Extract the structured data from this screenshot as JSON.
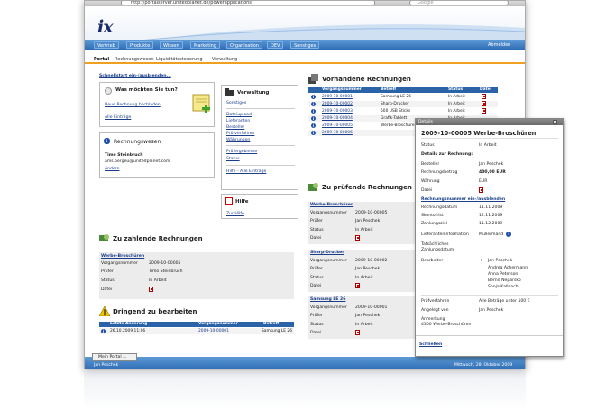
{
  "browser": {
    "url": "http://portalserver.unitedplanet.de/powerapplications/",
    "search_placeholder": "Google"
  },
  "app": {
    "logo_text": "ix"
  },
  "main_nav": [
    "Vertrieb",
    "Produkte",
    "Wissen",
    "Marketing",
    "Organisation",
    "DEV",
    "Sonstiges"
  ],
  "logout_label": "Abmelden",
  "sub_nav": [
    "Portal",
    "Rechnungswesen",
    "Liquiditätssteuerung",
    "Verwaltung"
  ],
  "quickstart_label": "Schnellstart ein-/ausblenden...",
  "wish": {
    "title": "Was möchten Sie tun?",
    "links": [
      "Neue Rechnung hochladen",
      "Alle Einträge"
    ]
  },
  "accounting_box": {
    "title": "Rechnungswesen",
    "name": "Timo Steinbruch",
    "email": "ams.bergeu@unitedplanet.com",
    "change_link": "Ändern"
  },
  "admin_box": {
    "title": "Verwaltung",
    "links": [
      "Sonstiges",
      "Dateiupload",
      "Lieferanten",
      "Besteller",
      "Prüfverfahren",
      "Währungen",
      "Prüfergebnisse",
      "Status",
      "Hilfe - Alle Einträge"
    ]
  },
  "help_box": {
    "title": "Hilfe",
    "links": [
      "Zur Hilfe"
    ]
  },
  "invoices": {
    "title": "Vorhandene Rechnungen",
    "columns": [
      "Vorgangsnummer",
      "Betreff",
      "Status",
      "Datei"
    ],
    "rows": [
      {
        "nr": "2009-10-00001",
        "subject": "Samsung LE 26",
        "status": "In Arbeit"
      },
      {
        "nr": "2009-10-00002",
        "subject": "Sharp-Drucker",
        "status": "In Arbeit"
      },
      {
        "nr": "2009-10-00003",
        "subject": "500 USB Sticks",
        "status": "In Arbeit"
      },
      {
        "nr": "2009-10-00004",
        "subject": "Grafik-Tablett",
        "status": "In Arbeit"
      },
      {
        "nr": "2009-10-00005",
        "subject": "Werbe-Broschüren",
        "status": "In Arbeit"
      },
      {
        "nr": "2009-10-00006",
        "subject": "",
        "status": ""
      }
    ]
  },
  "to_pay": {
    "title": "Zu zahlende Rechnungen",
    "item_title": "Werbe-Broschüren",
    "fields": [
      {
        "label": "Vorgangsnummer",
        "value": "2009-10-00005"
      },
      {
        "label": "Prüfer",
        "value": "Timo Steinbruch"
      },
      {
        "label": "Status",
        "value": "In Arbeit"
      },
      {
        "label": "Datei",
        "value": ""
      }
    ]
  },
  "urgent": {
    "title": "Dringend zu bearbeiten",
    "columns": [
      "Letzte Änderung",
      "Vorgangsnummer",
      "Betreff"
    ],
    "rows": [
      {
        "date": "26.10.2009 11:06",
        "nr": "2009-10-00001",
        "subject": "Samsung LE 26"
      }
    ]
  },
  "to_check": {
    "title": "Zu prüfende Rechnungen",
    "items": [
      {
        "title": "Werbe-Broschüren",
        "nr": "2009-10-00005",
        "checker": "Jan Peschek",
        "status": "In Arbeit"
      },
      {
        "title": "Sharp-Drucker",
        "nr": "2009-10-00002",
        "checker": "Jan Peschek",
        "status": "In Arbeit"
      },
      {
        "title": "Samsung LE 26",
        "nr": "2009-10-00001",
        "checker": "Jan Peschek",
        "status": "In Arbeit"
      }
    ],
    "labels": {
      "nr": "Vorgangsnummer",
      "checker": "Prüfer",
      "status": "Status",
      "file": "Datei"
    }
  },
  "detail": {
    "window_title": "Details",
    "heading": "2009-10-00005 Werbe-Broschüren",
    "status_label": "Status",
    "status_value": "In Arbeit",
    "section1": "Details zur Rechnung:",
    "fields1": [
      {
        "label": "Besteller",
        "value": "Jan Peschek"
      },
      {
        "label": "Rechnungsbetrag",
        "value": "400,00 EUR"
      },
      {
        "label": "Währung",
        "value": "EUR"
      },
      {
        "label": "Datei",
        "value": ""
      }
    ],
    "section2": "Rechnungsnummer ein-/ausblenden",
    "fields2": [
      {
        "label": "Rechnungsdatum",
        "value": "11.11.2009"
      },
      {
        "label": "Skontofrist",
        "value": "12.11.2009"
      },
      {
        "label": "Zahlungsziel",
        "value": "11.12.2009"
      },
      {
        "label": "Lieferanteninformation",
        "value": "Müllermand"
      }
    ],
    "payment_label1": "Tatsächliches",
    "payment_label2": "Zahlungsdatum",
    "editors_label": "Bearbeiter",
    "editors": [
      "Jan Peschek",
      "Andrea Achermann",
      "Anna Peterson",
      "Bernd Neparsko",
      "Sonja Kallbach"
    ],
    "check_label": "Prüfverfahren",
    "check_value": "Alle Beträge unter 500 €",
    "created_label": "Angelegt von",
    "created_value": "Jan Peschek",
    "note_label": "Anmerkung",
    "note_value": "4300 Werbe-Broschüren",
    "close_link": "Schließen"
  },
  "status_bar": {
    "my_portal": "Mein Portal ...",
    "user": "Jan Peschek",
    "date": "Mittwoch, 28. Oktober 2009"
  }
}
